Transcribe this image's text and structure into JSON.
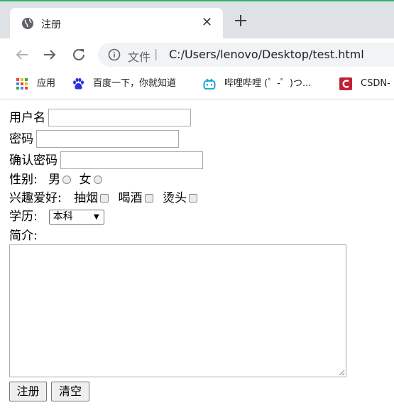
{
  "browser": {
    "tab_title": "注册",
    "omnibox": {
      "scheme_label": "文件",
      "separator": "|",
      "url": "C:/Users/lenovo/Desktop/test.html"
    },
    "bookmarks": [
      {
        "icon": "apps-grid-icon",
        "label": "应用"
      },
      {
        "icon": "baidu-paw-icon",
        "label": "百度一下，你就知道"
      },
      {
        "icon": "bilibili-tv-icon",
        "label": "哔哩哔哩 (゜-゜)つ..."
      },
      {
        "icon": "csdn-logo-icon",
        "label": "CSDN-"
      }
    ]
  },
  "form": {
    "username_label": "用户名",
    "password_label": "密码",
    "confirm_label": "确认密码",
    "gender_label": "性别:",
    "gender_male": "男",
    "gender_female": "女",
    "hobby_label": "兴趣爱好:",
    "hobby_smoke": "抽烟",
    "hobby_drink": "喝酒",
    "hobby_perm": "烫头",
    "edu_label": "学历:",
    "edu_selected": "本科",
    "intro_label": "简介:",
    "submit_label": "注册",
    "reset_label": "清空"
  },
  "colors": {
    "tabstrip": "#dee1e6",
    "omnibox": "#f1f3f4",
    "csdn_red": "#c32136",
    "bilibili_blue": "#00a1d6"
  }
}
